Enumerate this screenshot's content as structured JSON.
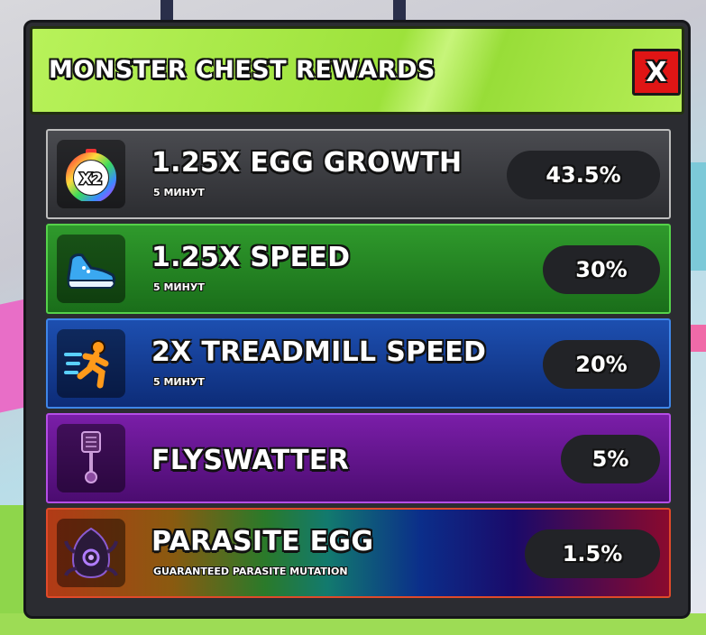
{
  "panel": {
    "title": "MONSTER CHEST REWARDS",
    "close_label": "X"
  },
  "rewards": [
    {
      "name": "1.25X EGG GROWTH",
      "sub": "5 МИНУТ",
      "percent": "43.5%",
      "icon": "x2-timer-icon",
      "color": "#3a3b40"
    },
    {
      "name": "1.25X SPEED",
      "sub": "5 МИНУТ",
      "percent": "30%",
      "icon": "shoe-icon",
      "color": "#25842a"
    },
    {
      "name": "2X TREADMILL SPEED",
      "sub": "5 МИНУТ",
      "percent": "20%",
      "icon": "running-man-icon",
      "color": "#163f9a"
    },
    {
      "name": "FLYSWATTER",
      "sub": "",
      "percent": "5%",
      "icon": "flyswatter-icon",
      "color": "#63168e"
    },
    {
      "name": "PARASITE EGG",
      "sub": "GUARANTEED PARASITE MUTATION",
      "percent": "1.5%",
      "icon": "parasite-egg-icon",
      "color": "#6a2a6a"
    }
  ]
}
